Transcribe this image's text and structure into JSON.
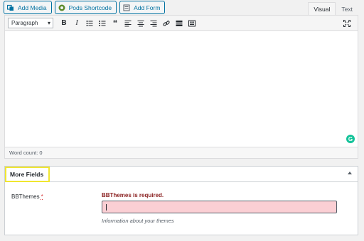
{
  "media_buttons": {
    "add_media": "Add Media",
    "pods_shortcode": "Pods Shortcode",
    "add_form": "Add Form"
  },
  "editor_tabs": {
    "visual": "Visual",
    "text": "Text",
    "active": "visual"
  },
  "toolbar": {
    "format_select": "Paragraph",
    "buttons": [
      "bold-icon",
      "italic-icon",
      "bullet-list-icon",
      "numbered-list-icon",
      "blockquote-icon",
      "align-left-icon",
      "align-center-icon",
      "align-right-icon",
      "link-icon",
      "read-more-icon",
      "toolbar-toggle-icon"
    ],
    "expand_icon": "fullscreen-icon"
  },
  "status_bar": {
    "word_count": "Word count: 0"
  },
  "metabox": {
    "title": "More Fields",
    "field": {
      "label": "BBThemes",
      "required_marker": "*",
      "error": "BBThemes is required.",
      "value": "",
      "help": "Information about your themes"
    }
  },
  "colors": {
    "accent": "#0071a1",
    "error_text": "#8a2020",
    "error_bg": "#fbcfd4",
    "highlight": "#f0e630",
    "grammarly": "#15c39a"
  }
}
